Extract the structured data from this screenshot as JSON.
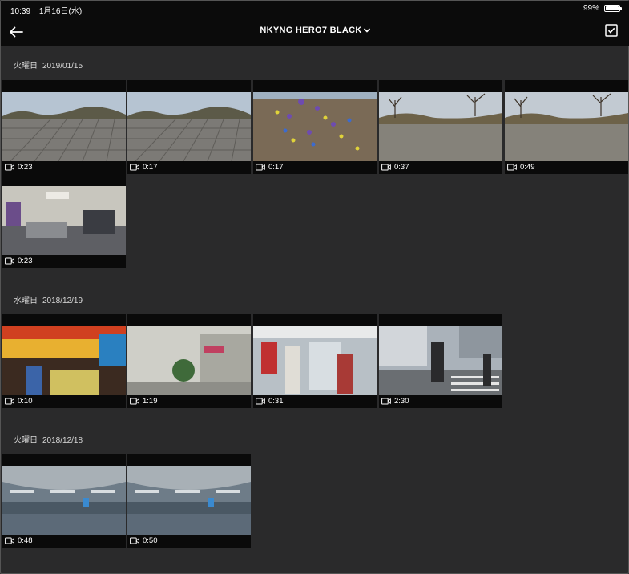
{
  "status": {
    "time": "10:39",
    "date": "1月16日(水)",
    "battery": "99%",
    "battery_level": 0.99
  },
  "nav": {
    "title": "NKYNG HERO7 BLACK",
    "back_icon": "arrow-left-icon",
    "select_icon": "checkbox-checked-icon",
    "dropdown_icon": "chevron-down-icon"
  },
  "sections": [
    {
      "day": "火曜日",
      "date": "2019/01/15",
      "videos": [
        {
          "duration": "0:23",
          "scene": "plaza-pavement"
        },
        {
          "duration": "0:17",
          "scene": "plaza-pavement"
        },
        {
          "duration": "0:17",
          "scene": "flowerbed"
        },
        {
          "duration": "0:37",
          "scene": "park-path"
        },
        {
          "duration": "0:49",
          "scene": "park-path"
        },
        {
          "duration": "0:23",
          "scene": "indoor-room"
        }
      ]
    },
    {
      "day": "水曜日",
      "date": "2018/12/19",
      "videos": [
        {
          "duration": "0:10",
          "scene": "market-stall"
        },
        {
          "duration": "1:19",
          "scene": "street-wall"
        },
        {
          "duration": "0:31",
          "scene": "shop-front"
        },
        {
          "duration": "2:30",
          "scene": "city-crosswalk"
        }
      ]
    },
    {
      "day": "火曜日",
      "date": "2018/12/18",
      "videos": [
        {
          "duration": "0:48",
          "scene": "airport-hall"
        },
        {
          "duration": "0:50",
          "scene": "airport-hall"
        }
      ]
    }
  ]
}
